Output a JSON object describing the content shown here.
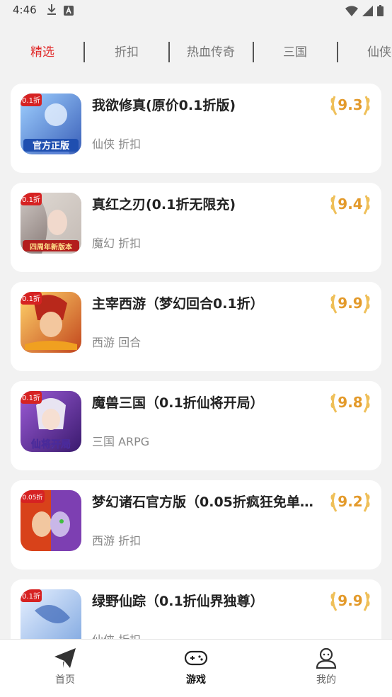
{
  "status_bar": {
    "time": "4:46",
    "left_icons": [
      "download-icon",
      "a-letter-icon"
    ],
    "right_icons": [
      "wifi-icon",
      "signal-icon",
      "battery-icon"
    ]
  },
  "tabs": [
    {
      "label": "精选",
      "active": true
    },
    {
      "label": "折扣",
      "active": false
    },
    {
      "label": "热血传奇",
      "active": false
    },
    {
      "label": "三国",
      "active": false
    },
    {
      "label": "仙侠",
      "active": false
    }
  ],
  "games": [
    {
      "title": "我欲修真(原价0.1折版)",
      "tags": "仙侠 折扣",
      "rating": "9.3",
      "icon_badge": "0.1折",
      "icon_caption": "官方正版"
    },
    {
      "title": "真红之刃(0.1折无限充)",
      "tags": "魔幻 折扣",
      "rating": "9.4",
      "icon_badge": "0.1折",
      "icon_caption": "四周年新版本"
    },
    {
      "title": "主宰西游（梦幻回合0.1折）",
      "tags": "西游 回合",
      "rating": "9.9",
      "icon_badge": "0.1折",
      "icon_caption": ""
    },
    {
      "title": "魔兽三国（0.1折仙将开局）",
      "tags": "三国 ARPG",
      "rating": "9.8",
      "icon_badge": "0.1折",
      "icon_caption": "仙将开局"
    },
    {
      "title": "梦幻诸石官方版（0.05折疯狂免单…",
      "tags": "西游 折扣",
      "rating": "9.2",
      "icon_badge": "0.05折",
      "icon_caption": ""
    },
    {
      "title": "绿野仙踪（0.1折仙界独尊）",
      "tags": "仙侠 折扣",
      "rating": "9.9",
      "icon_badge": "0.1折",
      "icon_caption": ""
    }
  ],
  "bottom_nav": [
    {
      "label": "首页",
      "icon": "paper-plane-icon",
      "active": false
    },
    {
      "label": "游戏",
      "icon": "gamepad-icon",
      "active": true
    },
    {
      "label": "我的",
      "icon": "user-icon",
      "active": false
    }
  ],
  "colors": {
    "accent_red": "#e02b2b",
    "rating_gold": "#e39a2b",
    "background": "#f2f2f2"
  }
}
